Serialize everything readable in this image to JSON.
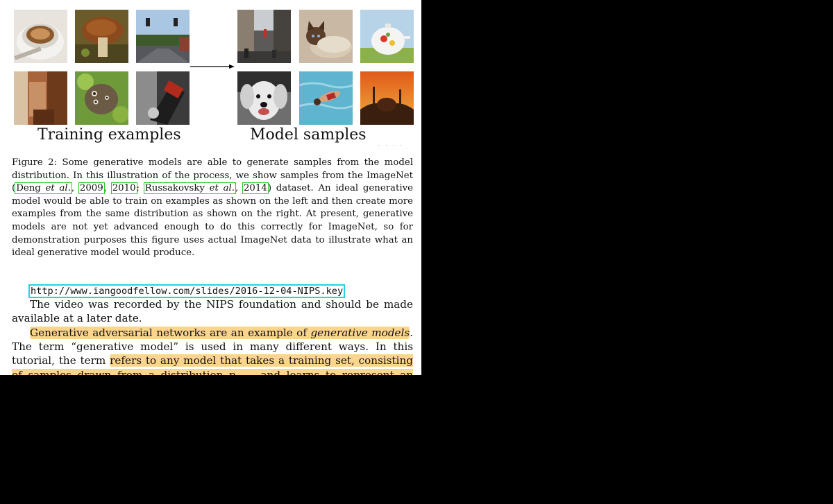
{
  "figure": {
    "left_label": "Training examples",
    "right_label": "Model samples",
    "cut_mark": "· · · ·",
    "thumbs": [
      {
        "name": "coffee-cup-thumb"
      },
      {
        "name": "mushroom-thumb"
      },
      {
        "name": "street-thumb"
      },
      {
        "name": "interior-thumb"
      },
      {
        "name": "butterfly-thumb"
      },
      {
        "name": "drill-thumb"
      },
      {
        "name": "city-street-thumb"
      },
      {
        "name": "cat-thumb"
      },
      {
        "name": "teapot-thumb"
      },
      {
        "name": "dog-thumb"
      },
      {
        "name": "swimmer-thumb"
      },
      {
        "name": "mosque-sunset-thumb"
      }
    ]
  },
  "caption": {
    "part1": "Figure 2: Some generative models are able to generate samples from the model distribution. In this illustration of the process, we show samples from the ImageNet (",
    "cite_deng": "Deng",
    "cite_deng_etal": "et al.",
    "sep1": ", ",
    "cite_2009": "2009",
    "sep2": ", ",
    "cite_2010": "2010",
    "sep3": "; ",
    "cite_russ": "Russakovsky",
    "cite_russ_etal": "et al.",
    "sep4": ", ",
    "cite_2014": "2014",
    "part2": ") dataset. An ideal generative model would be able to train on examples as shown on the left and then create more examples from the same distribution as shown on the right. At present, generative models are not yet advanced enough to do this correctly for ImageNet, so for demonstration purposes this figure uses actual ImageNet data to illustrate what an ideal generative model would produce."
  },
  "url": "http://www.iangoodfellow.com/slides/2016-12-04-NIPS.key",
  "video_text": "The video was recorded by the NIPS foundation and should be made available at a later date.",
  "gan_para": {
    "hl1": "Generative adversarial networks are an example of ",
    "hl1_italic": "generative models",
    "mid": ". The term “generative model” is used in many different ways. In this tutorial, the term ",
    "hl2": "refers to any model that takes a training set, consisting of samples drawn from a distribution p",
    "hl2_sub": "data",
    "hl2_end": ", and learns to represent an estimate of that distribution"
  }
}
